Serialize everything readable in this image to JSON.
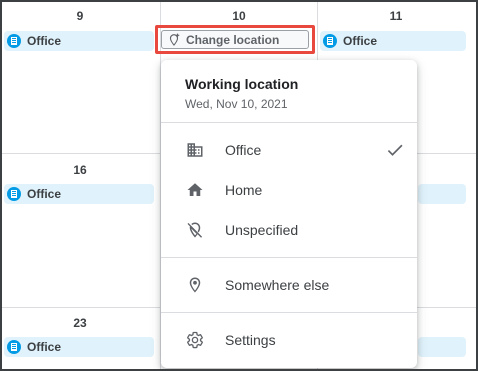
{
  "calendar": {
    "day_numbers": [
      "9",
      "10",
      "11",
      "16",
      "23"
    ],
    "chip_label": "Office"
  },
  "change_location": {
    "label": "Change location"
  },
  "menu": {
    "title": "Working location",
    "date": "Wed, Nov 10, 2021",
    "items": [
      {
        "label": "Office",
        "icon": "office-building-icon",
        "selected": true
      },
      {
        "label": "Home",
        "icon": "home-icon",
        "selected": false
      },
      {
        "label": "Unspecified",
        "icon": "location-off-icon",
        "selected": false
      },
      {
        "label": "Somewhere else",
        "icon": "location-pin-icon",
        "selected": false
      },
      {
        "label": "Settings",
        "icon": "gear-icon",
        "selected": false
      }
    ]
  },
  "colors": {
    "chip_bg": "#e0f2fb",
    "chip_icon": "#039be5",
    "highlight": "#e8483e"
  }
}
